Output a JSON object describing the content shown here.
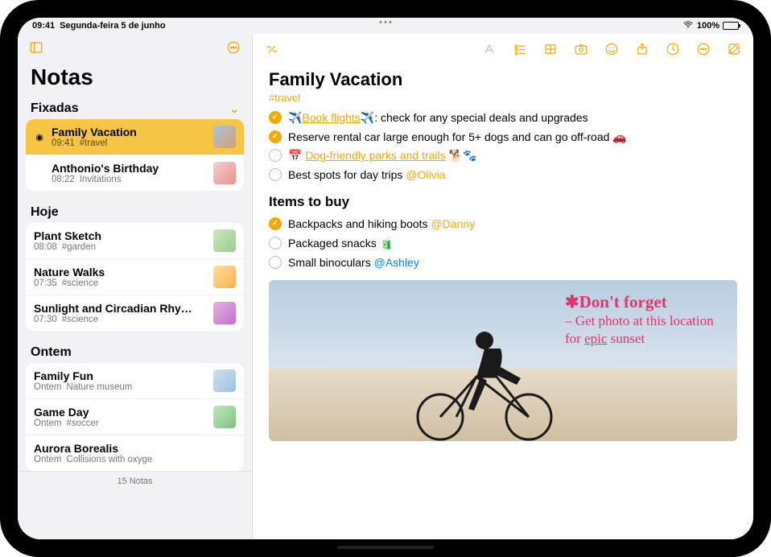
{
  "status": {
    "time": "09:41",
    "date": "Segunda-feira 5 de junho",
    "battery": "100%"
  },
  "sidebar": {
    "title": "Notas",
    "sections": [
      {
        "header": "Fixadas",
        "collapsible": true,
        "items": [
          {
            "title": "Family Vacation",
            "time": "09:41",
            "sub": "#travel",
            "pinned": true,
            "selected": true
          },
          {
            "title": "Anthonio's Birthday",
            "time": "08:22",
            "sub": "Invitations",
            "pinned": false,
            "selected": false
          }
        ]
      },
      {
        "header": "Hoje",
        "items": [
          {
            "title": "Plant Sketch",
            "time": "08:08",
            "sub": "#garden"
          },
          {
            "title": "Nature Walks",
            "time": "07:35",
            "sub": "#science"
          },
          {
            "title": "Sunlight and Circadian Rhy…",
            "time": "07:30",
            "sub": "#science"
          }
        ]
      },
      {
        "header": "Ontem",
        "items": [
          {
            "title": "Family Fun",
            "time": "Ontem",
            "sub": "Nature museum"
          },
          {
            "title": "Game Day",
            "time": "Ontem",
            "sub": "#soccer"
          },
          {
            "title": "Aurora Borealis",
            "time": "Ontem",
            "sub": "Collisions with oxyge"
          }
        ]
      }
    ],
    "footer": "15 Notas"
  },
  "note": {
    "title": "Family Vacation",
    "tag": "#travel",
    "list1": [
      {
        "checked": true,
        "pre": "✈️",
        "link": "Book flights",
        "post": "✈️: check for any special deals and upgrades"
      },
      {
        "checked": true,
        "text": "Reserve rental car large enough for 5+ dogs and can go off-road 🚗"
      },
      {
        "checked": false,
        "grey": true,
        "preicon": "📅",
        "link": "Dog-friendly parks and trails",
        "post": " 🐕🐾"
      },
      {
        "checked": false,
        "grey": true,
        "text": "Best spots for day trips ",
        "mention": "@Olivia"
      }
    ],
    "section2": "Items to buy",
    "list2": [
      {
        "checked": true,
        "text": "Backpacks and hiking boots ",
        "mention": "@Danny"
      },
      {
        "checked": false,
        "grey": true,
        "text": "Packaged snacks 🧃"
      },
      {
        "checked": false,
        "grey": true,
        "text": "Small binoculars ",
        "mention": "@Ashley",
        "mentionBlue": true
      }
    ],
    "handwriting": {
      "line1": "✱Don't forget",
      "line2": "– Get photo at this location for ",
      "emph": "epic",
      "line3": " sunset"
    }
  }
}
